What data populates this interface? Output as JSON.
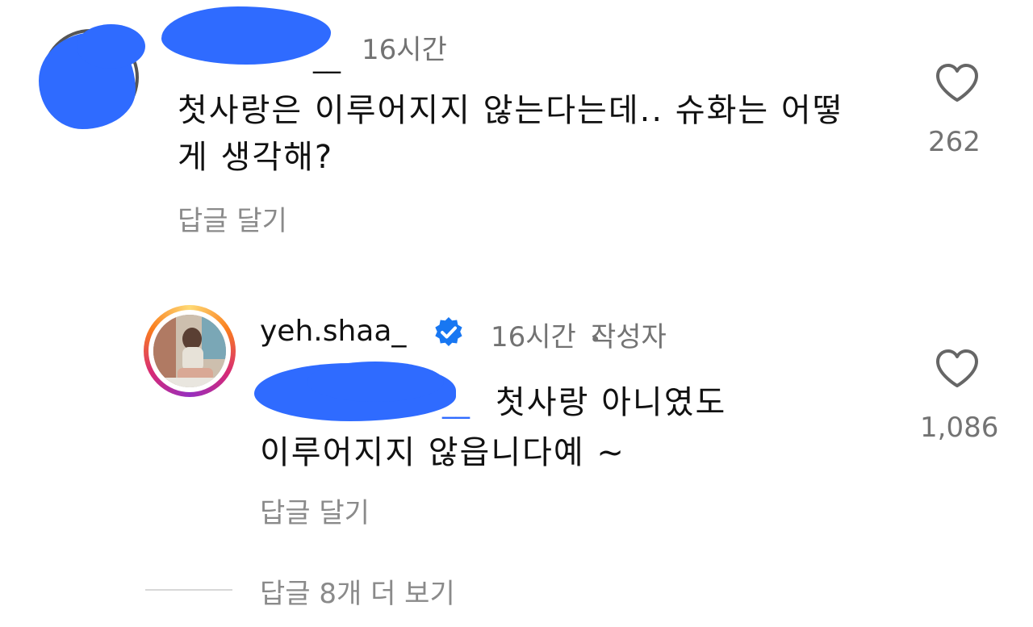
{
  "comment": {
    "username_tail": "__",
    "time": "16시간",
    "text": "첫사랑은 이루어지지 않는다는데.. 슈화는 어떻게 생각해?",
    "reply_label": "답글 달기",
    "like_count": "262",
    "like_icon": "heart-outline-icon"
  },
  "reply": {
    "username": "yeh.shaa_",
    "verified_icon": "verified-badge-icon",
    "time": "16시간",
    "separator": "•",
    "author_label": "작성자",
    "mention_tail": "__",
    "text_line1": "첫사랑 아니였도",
    "text_line2": "이루어지지 않읍니다예 ~",
    "reply_label": "답글 달기",
    "like_count": "1,086",
    "like_icon": "heart-outline-icon"
  },
  "more_replies": "답글 8개 더 보기",
  "colors": {
    "redaction": "#2f6bff",
    "verified": "#1877f2",
    "secondary_text": "#737373"
  }
}
